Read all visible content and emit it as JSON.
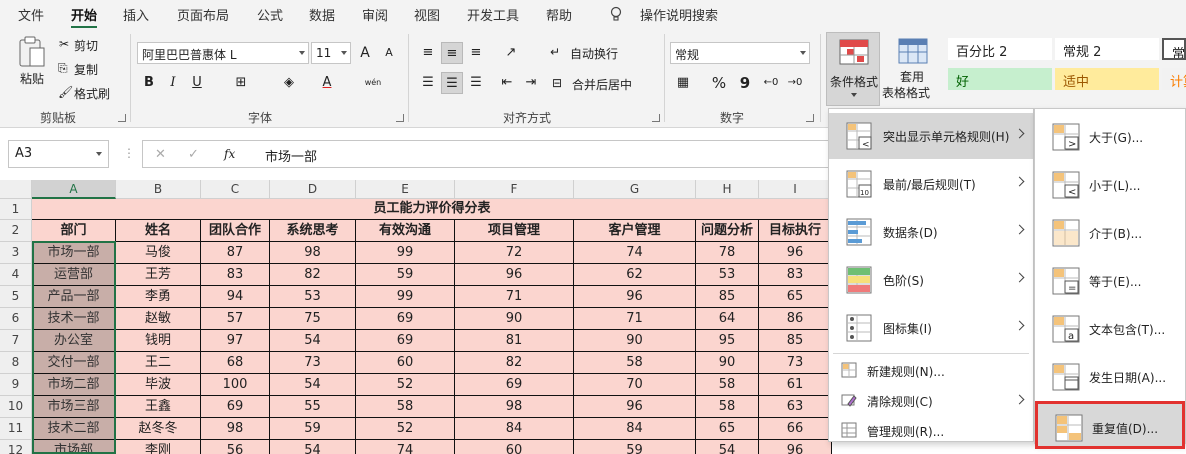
{
  "menubar": {
    "tabs": [
      "文件",
      "开始",
      "插入",
      "页面布局",
      "公式",
      "数据",
      "审阅",
      "视图",
      "开发工具",
      "帮助"
    ],
    "active": "开始",
    "tell_me": "操作说明搜索"
  },
  "ribbon": {
    "clipboard": {
      "paste": "粘贴",
      "cut": "剪切",
      "copy": "复制",
      "format_painter": "格式刷",
      "label": "剪贴板"
    },
    "font": {
      "name": "阿里巴巴普惠体 L",
      "size": "11",
      "grow": "A",
      "shrink": "A",
      "bold": "B",
      "italic": "I",
      "underline": "U",
      "font_color": "A",
      "phonetic": "wén",
      "label": "字体"
    },
    "alignment": {
      "wrap_text": "自动换行",
      "merge_center": "合并后居中",
      "label": "对齐方式"
    },
    "number": {
      "format": "常规",
      "percent": "%",
      "comma": "9",
      "label": "数字"
    },
    "styles": {
      "conditional_formatting": "条件格式",
      "format_as_table": [
        "套用",
        "表格格式"
      ],
      "cells": [
        {
          "label": "百分比 2",
          "bg": "#ffffff",
          "color": "#222222"
        },
        {
          "label": "常规 2",
          "bg": "#ffffff",
          "color": "#222222"
        },
        {
          "label": "常规",
          "bg": "#ffffff",
          "color": "#222222"
        },
        {
          "label": "好",
          "bg": "#c6efce",
          "color": "#006100"
        },
        {
          "label": "适中",
          "bg": "#ffeb9c",
          "color": "#9c5700"
        },
        {
          "label": "计算",
          "bg": "#f2f2f2",
          "color": "#fa7d00"
        }
      ]
    }
  },
  "formula_bar": {
    "name_box": "A3",
    "cancel": "✕",
    "enter": "✓",
    "fx": "fx",
    "content": "市场一部"
  },
  "sheet": {
    "columns": [
      "A",
      "B",
      "C",
      "D",
      "E",
      "F",
      "G",
      "H",
      "I"
    ],
    "row_numbers": [
      "1",
      "2",
      "3",
      "4",
      "5",
      "6",
      "7",
      "8",
      "9",
      "10",
      "11",
      "12"
    ],
    "title": "员工能力评价得分表",
    "headers": [
      "部门",
      "姓名",
      "团队合作",
      "系统思考",
      "有效沟通",
      "项目管理",
      "客户管理",
      "问题分析",
      "目标执行"
    ],
    "rows": [
      [
        "市场一部",
        "马俊",
        "87",
        "98",
        "99",
        "72",
        "74",
        "78",
        "96"
      ],
      [
        "运营部",
        "王芳",
        "83",
        "82",
        "59",
        "96",
        "62",
        "53",
        "83"
      ],
      [
        "产品一部",
        "李勇",
        "94",
        "53",
        "99",
        "71",
        "96",
        "85",
        "65"
      ],
      [
        "技术一部",
        "赵敏",
        "57",
        "75",
        "69",
        "90",
        "71",
        "64",
        "86"
      ],
      [
        "办公室",
        "钱明",
        "97",
        "54",
        "69",
        "81",
        "90",
        "95",
        "85"
      ],
      [
        "交付一部",
        "王二",
        "68",
        "73",
        "60",
        "82",
        "58",
        "90",
        "73"
      ],
      [
        "市场二部",
        "毕波",
        "100",
        "54",
        "52",
        "69",
        "70",
        "58",
        "61"
      ],
      [
        "市场三部",
        "王鑫",
        "69",
        "55",
        "58",
        "98",
        "96",
        "58",
        "63"
      ],
      [
        "技术二部",
        "赵冬冬",
        "98",
        "59",
        "52",
        "84",
        "84",
        "65",
        "66"
      ],
      [
        "市场部",
        "李刚",
        "56",
        "54",
        "74",
        "60",
        "59",
        "54",
        "96"
      ]
    ]
  },
  "cf_menu": {
    "items": [
      {
        "label": "突出显示单元格规则(H)",
        "icon": "highlight-rules-icon"
      },
      {
        "label": "最前/最后规则(T)",
        "icon": "top-bottom-rules-icon"
      },
      {
        "label": "数据条(D)",
        "icon": "data-bars-icon"
      },
      {
        "label": "色阶(S)",
        "icon": "color-scales-icon"
      },
      {
        "label": "图标集(I)",
        "icon": "icon-sets-icon"
      }
    ],
    "bottom_items": [
      {
        "label": "新建规则(N)...",
        "icon": "new-rule-icon"
      },
      {
        "label": "清除规则(C)",
        "icon": "clear-rules-icon"
      },
      {
        "label": "管理规则(R)...",
        "icon": "manage-rules-icon"
      }
    ]
  },
  "highlight_submenu": {
    "items": [
      {
        "label": "大于(G)...",
        "icon": "greater-than-icon"
      },
      {
        "label": "小于(L)...",
        "icon": "less-than-icon"
      },
      {
        "label": "介于(B)...",
        "icon": "between-icon"
      },
      {
        "label": "等于(E)...",
        "icon": "equal-to-icon"
      },
      {
        "label": "文本包含(T)...",
        "icon": "text-contains-icon"
      },
      {
        "label": "发生日期(A)...",
        "icon": "date-occurring-icon"
      },
      {
        "label": "重复值(D)...",
        "icon": "duplicate-values-icon"
      }
    ]
  }
}
